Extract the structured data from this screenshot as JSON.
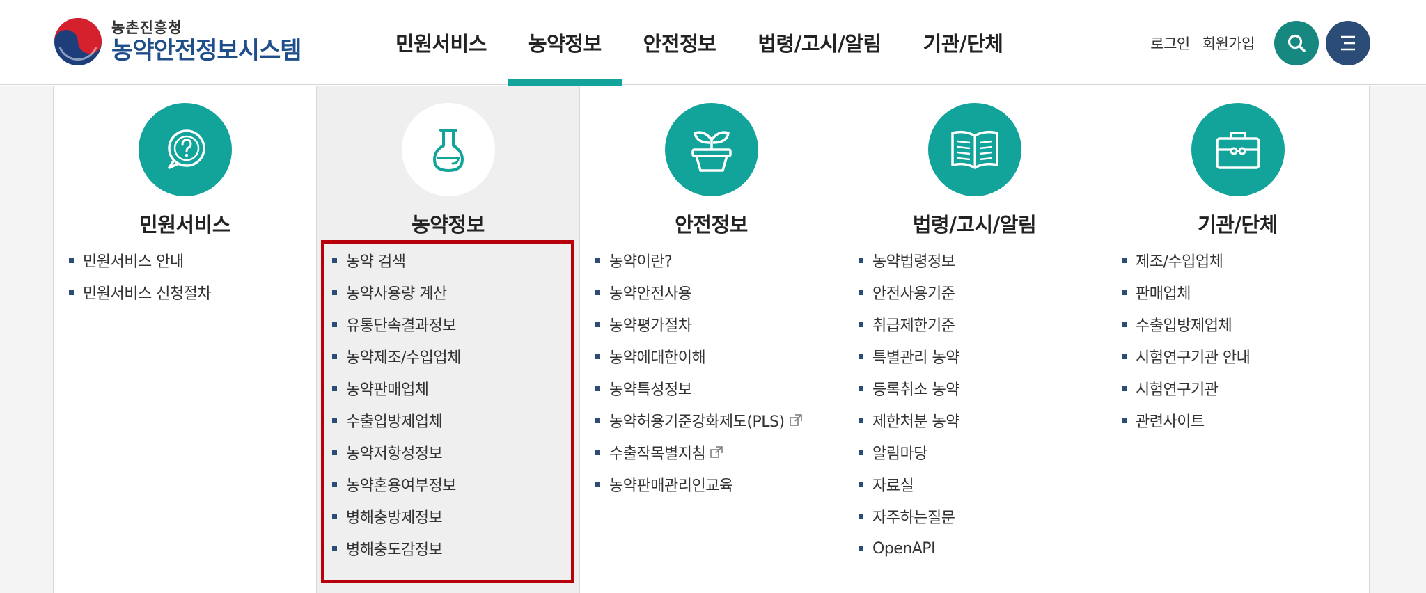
{
  "logo": {
    "sub": "농촌진흥청",
    "main": "농약안전정보시스템"
  },
  "gnb": {
    "items": [
      {
        "label": "민원서비스"
      },
      {
        "label": "농약정보"
      },
      {
        "label": "안전정보"
      },
      {
        "label": "법령/고시/알림"
      },
      {
        "label": "기관/단체"
      }
    ],
    "active_index": 1
  },
  "util": {
    "login": "로그인",
    "signup": "회원가입"
  },
  "colors": {
    "teal": "#12a39a",
    "navy": "#2c4c78",
    "highlight": "#b8000b"
  },
  "menu": {
    "columns": [
      {
        "title": "민원서비스",
        "icon": "question-chat-icon",
        "items": [
          "민원서비스 안내",
          "민원서비스 신청절차"
        ]
      },
      {
        "title": "농약정보",
        "icon": "flask-icon",
        "items": [
          "농약 검색",
          "농약사용량 계산",
          "유통단속결과정보",
          "농약제조/수입업체",
          "농약판매업체",
          "수출입방제업체",
          "농약저항성정보",
          "농약혼용여부정보",
          "병해충방제정보",
          "병해충도감정보"
        ]
      },
      {
        "title": "안전정보",
        "icon": "sprout-pot-icon",
        "items": [
          "농약이란?",
          "농약안전사용",
          "농약평가절차",
          "농약에대한이해",
          "농약특성정보",
          "농약허용기준강화제도(PLS)",
          "수출작목별지침",
          "농약판매관리인교육"
        ]
      },
      {
        "title": "법령/고시/알림",
        "icon": "open-book-icon",
        "items": [
          "농약법령정보",
          "안전사용기준",
          "취급제한기준",
          "특별관리 농약",
          "등록취소 농약",
          "제한처분 농약",
          "알림마당",
          "자료실",
          "자주하는질문",
          "OpenAPI"
        ]
      },
      {
        "title": "기관/단체",
        "icon": "briefcase-icon",
        "items": [
          "제조/수입업체",
          "판매업체",
          "수출입방제업체",
          "시험연구기관 안내",
          "시험연구기관",
          "관련사이트"
        ]
      }
    ]
  }
}
